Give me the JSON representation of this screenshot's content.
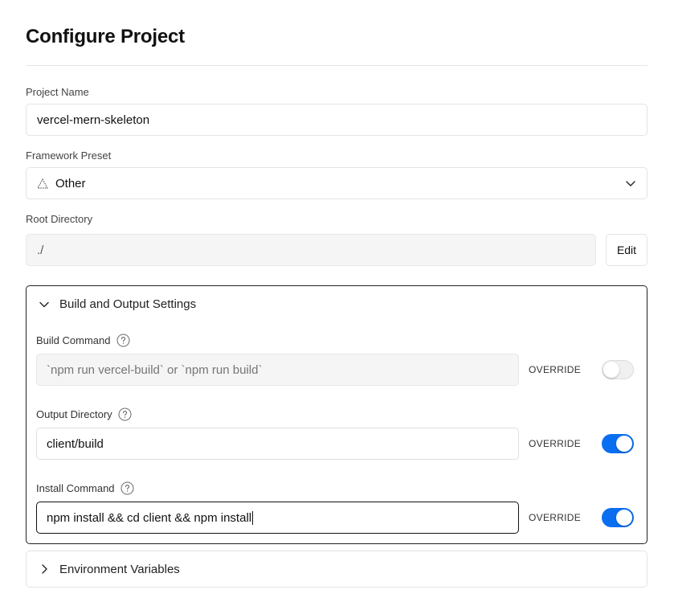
{
  "header": {
    "title": "Configure Project"
  },
  "project_name": {
    "label": "Project Name",
    "value": "vercel-mern-skeleton"
  },
  "framework": {
    "label": "Framework Preset",
    "value": "Other",
    "icon": "triangle-icon"
  },
  "root_directory": {
    "label": "Root Directory",
    "value": "./",
    "edit_label": "Edit"
  },
  "build_settings": {
    "title": "Build and Output Settings",
    "expanded": true,
    "build_command": {
      "label": "Build Command",
      "placeholder": "`npm run vercel-build` or `npm run build`",
      "override_label": "OVERRIDE",
      "override_enabled": false
    },
    "output_directory": {
      "label": "Output Directory",
      "value": "client/build",
      "override_label": "OVERRIDE",
      "override_enabled": true
    },
    "install_command": {
      "label": "Install Command",
      "value": "npm install && cd client && npm install",
      "override_label": "OVERRIDE",
      "override_enabled": true
    }
  },
  "environment_variables": {
    "title": "Environment Variables",
    "expanded": false
  },
  "colors": {
    "accent": "#0a6ef0",
    "border": "#e3e3e3",
    "panel_border_active": "#222222"
  }
}
